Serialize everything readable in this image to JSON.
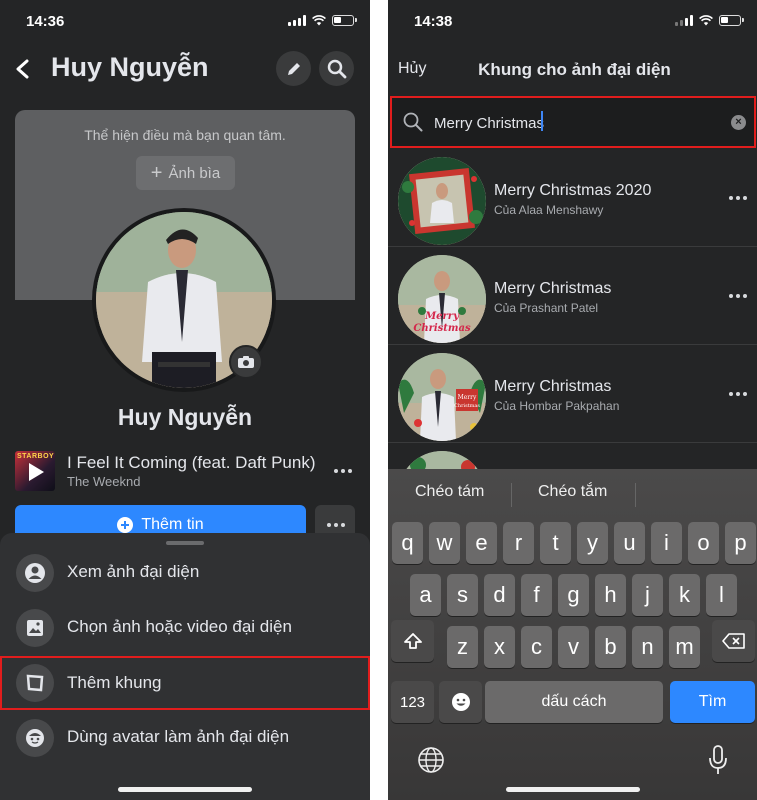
{
  "left": {
    "status": {
      "time": "14:36"
    },
    "header": {
      "name": "Huy Nguyễn"
    },
    "cover": {
      "hint": "Thể hiện điều mà bạn quan tâm.",
      "button_label": "Ảnh bìa"
    },
    "profile_name": "Huy Nguyễn",
    "song": {
      "album_tag": "STARBOY",
      "title": "I Feel It Coming (feat. Daft Punk)",
      "artist": "The Weeknd"
    },
    "add_story_label": "Thêm tin",
    "menu": [
      {
        "label": "Xem ảnh đại diện",
        "icon": "person-circle-icon"
      },
      {
        "label": "Chọn ảnh hoặc video đại diện",
        "icon": "image-icon"
      },
      {
        "label": "Thêm khung",
        "icon": "frame-icon",
        "highlighted": true
      },
      {
        "label": "Dùng avatar làm ảnh đại diện",
        "icon": "avatar-icon"
      }
    ]
  },
  "right": {
    "status": {
      "time": "14:38"
    },
    "cancel_label": "Hủy",
    "title": "Khung cho ảnh đại diện",
    "search": {
      "value": "Merry Christmas",
      "placeholder": ""
    },
    "frames": [
      {
        "title": "Merry Christmas 2020",
        "author": "Của Alaa Menshawy"
      },
      {
        "title": "Merry Christmas",
        "author": "Của Prashant Patel"
      },
      {
        "title": "Merry Christmas",
        "author": "Của Hombar Pakpahan"
      }
    ],
    "keyboard": {
      "suggestions": [
        "Chéo tám",
        "Chéo tắm"
      ],
      "row1": [
        "q",
        "w",
        "e",
        "r",
        "t",
        "y",
        "u",
        "i",
        "o",
        "p"
      ],
      "row2": [
        "a",
        "s",
        "d",
        "f",
        "g",
        "h",
        "j",
        "k",
        "l"
      ],
      "row3": [
        "z",
        "x",
        "c",
        "v",
        "b",
        "n",
        "m"
      ],
      "numbers_label": "123",
      "space_label": "dấu cách",
      "go_label": "Tìm"
    }
  },
  "colors": {
    "accent": "#2d88ff",
    "highlight": "#e11d1d",
    "background": "#242526"
  }
}
